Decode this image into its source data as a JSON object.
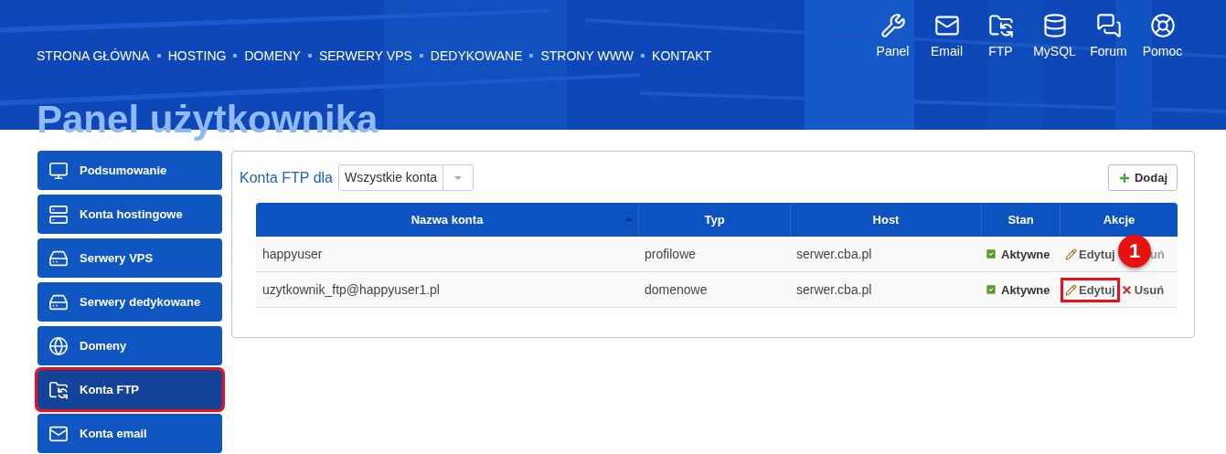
{
  "nav": [
    "STRONA GŁÓWNA",
    "HOSTING",
    "DOMENY",
    "SERWERY VPS",
    "DEDYKOWANE",
    "STRONY WWW",
    "KONTAKT"
  ],
  "header_links": [
    {
      "label": "Panel"
    },
    {
      "label": "Email"
    },
    {
      "label": "FTP"
    },
    {
      "label": "MySQL"
    },
    {
      "label": "Forum"
    },
    {
      "label": "Pomoc"
    }
  ],
  "page_title": "Panel użytkownika",
  "sidebar": {
    "items": [
      {
        "label": "Podsumowanie",
        "selected": false,
        "highlighted": false
      },
      {
        "label": "Konta hostingowe",
        "selected": false,
        "highlighted": false
      },
      {
        "label": "Serwery VPS",
        "selected": false,
        "highlighted": false
      },
      {
        "label": "Serwery dedykowane",
        "selected": false,
        "highlighted": false
      },
      {
        "label": "Domeny",
        "selected": false,
        "highlighted": false
      },
      {
        "label": "Konta FTP",
        "selected": true,
        "highlighted": true
      },
      {
        "label": "Konta email",
        "selected": false,
        "highlighted": false
      }
    ]
  },
  "panel": {
    "title": "Konta FTP dla",
    "filter": {
      "value": "Wszystkie konta"
    },
    "add_button": "Dodaj",
    "table": {
      "columns": [
        {
          "label": "Nazwa konta",
          "sorted": true
        },
        {
          "label": "Typ",
          "sorted": false
        },
        {
          "label": "Host",
          "sorted": false
        },
        {
          "label": "Stan",
          "sorted": false
        },
        {
          "label": "Akcje",
          "sorted": false
        }
      ],
      "rows": [
        {
          "name": "happyuser",
          "type": "profilowe",
          "host": "serwer.cba.pl",
          "status": "Aktywne",
          "badge": "1",
          "actions": [
            {
              "kind": "edit",
              "label": "Edytuj",
              "highlighted": false
            },
            {
              "kind": "covered",
              "label": "uń",
              "highlighted": false
            }
          ]
        },
        {
          "name": "uzytkownik_ftp@happyuser1.pl",
          "type": "domenowe",
          "host": "serwer.cba.pl",
          "status": "Aktywne",
          "actions": [
            {
              "kind": "edit",
              "label": "Edytuj",
              "highlighted": true
            },
            {
              "kind": "delete",
              "label": "Usuń",
              "highlighted": false
            }
          ]
        }
      ]
    }
  }
}
